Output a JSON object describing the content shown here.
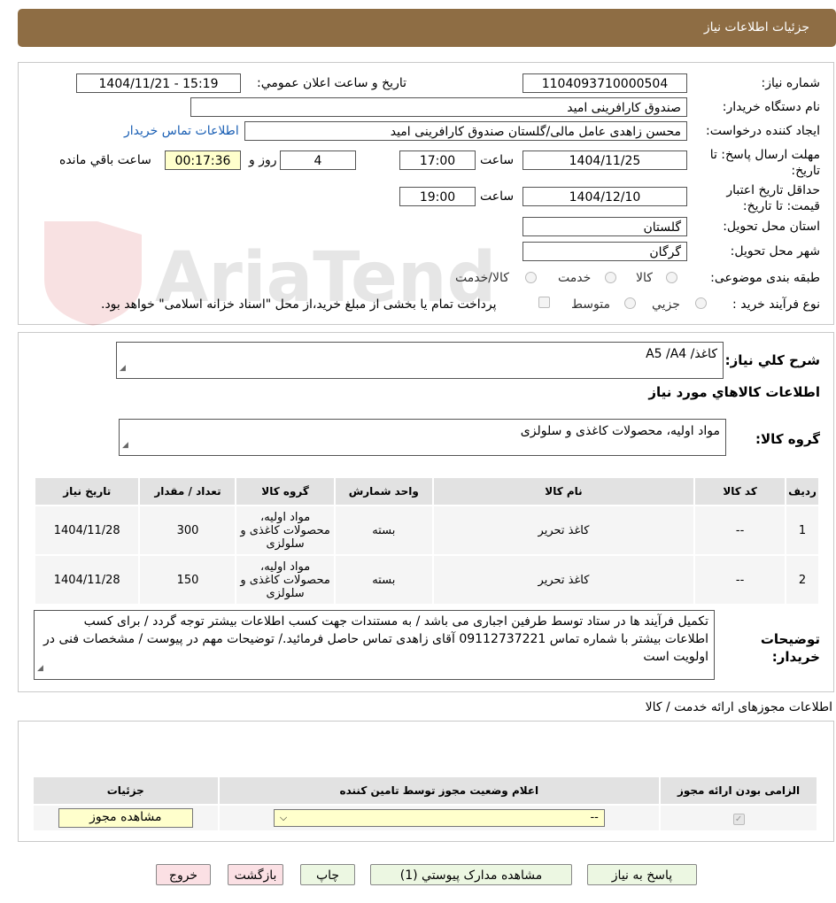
{
  "header": {
    "title": "جزئیات اطلاعات نیاز"
  },
  "fields": {
    "need_number_label": "شماره نیاز:",
    "need_number": "1104093710000504",
    "announce_label": "تاریخ و ساعت اعلان عمومي:",
    "announce_value": "1404/11/21 - 15:19",
    "buyer_org_label": "نام دستگاه خریدار:",
    "buyer_org": "صندوق كارافرینی امید",
    "creator_label": "ایجاد کننده درخواست:",
    "creator": "محسن زاهدی عامل مالی/گلستان صندوق كارافرینی امید",
    "contact_link": "اطلاعات تماس خریدار",
    "deadline_label": "مهلت ارسال پاسخ: تا تاریخ:",
    "deadline_date": "1404/11/25",
    "time_label": "ساعت",
    "deadline_time": "17:00",
    "days_value": "4",
    "days_label": "روز و",
    "remaining_time": "00:17:36",
    "remaining_label": "ساعت باقي مانده",
    "validity_label": "حداقل تاریخ اعتبار قیمت: تا تاریخ:",
    "validity_date": "1404/12/10",
    "validity_time": "19:00",
    "province_label": "استان محل تحویل:",
    "province": "گلستان",
    "city_label": "شهر محل تحویل:",
    "city": "گرگان",
    "category_label": "طبقه بندی موضوعی:",
    "category_options": [
      "کالا",
      "خدمت",
      "کالا/خدمت"
    ],
    "process_label": "نوع فرآیند خرید :",
    "process_options": [
      "جزیي",
      "متوسط"
    ],
    "process_note": "پرداخت تمام یا بخشی از مبلغ خرید،از محل \"اسناد خزانه اسلامی\" خواهد بود."
  },
  "watermark": "AriaTender.neT",
  "description": {
    "label": "شرح كلي نیاز:",
    "value": "کاغذ/ A5 /A4"
  },
  "goods": {
    "section_title": "اطلاعات کالاهاي مورد نیاز",
    "group_label": "گروه کالا:",
    "group_value": "مواد اولیه، محصولات کاغذی و سلولزی",
    "columns": [
      "ردیف",
      "کد کالا",
      "نام کالا",
      "واحد شمارش",
      "گروه کالا",
      "تعداد / مقدار",
      "تاریخ نیاز"
    ],
    "rows": [
      [
        "1",
        "--",
        "کاغذ تحریر",
        "بسته",
        "مواد اولیه، محصولات کاغذی و سلولزی",
        "300",
        "1404/11/28"
      ],
      [
        "2",
        "--",
        "کاغذ تحریر",
        "بسته",
        "مواد اولیه، محصولات کاغذی و سلولزی",
        "150",
        "1404/11/28"
      ]
    ]
  },
  "buyer_notes": {
    "label": "توضیحات خریدار:",
    "value": "تکمیل فرآیند ها در ستاد توسط طرفین اجباری می باشد / به مستندات جهت کسب اطلاعات بیشتر توجه گردد / برای کسب اطلاعات بیشتر با شماره تماس 09112737221 آقای زاهدی تماس حاصل فرمائید./ توضیحات مهم در پیوست / مشخصات فنی در اولویت است"
  },
  "permits": {
    "section_title": "اطلاعات مجوزهای ارائه خدمت / کالا",
    "columns": [
      "الزامی بودن ارائه مجوز",
      "اعلام وضعیت مجوز توسط تامین کننده",
      "جزئیات"
    ],
    "select_value": "--",
    "view_button": "مشاهده مجوز"
  },
  "buttons": {
    "reply": "پاسخ به نیاز",
    "attachments": "مشاهده مدارک پیوستي (1)",
    "print": "چاپ",
    "back": "بازگشت",
    "exit": "خروج"
  }
}
